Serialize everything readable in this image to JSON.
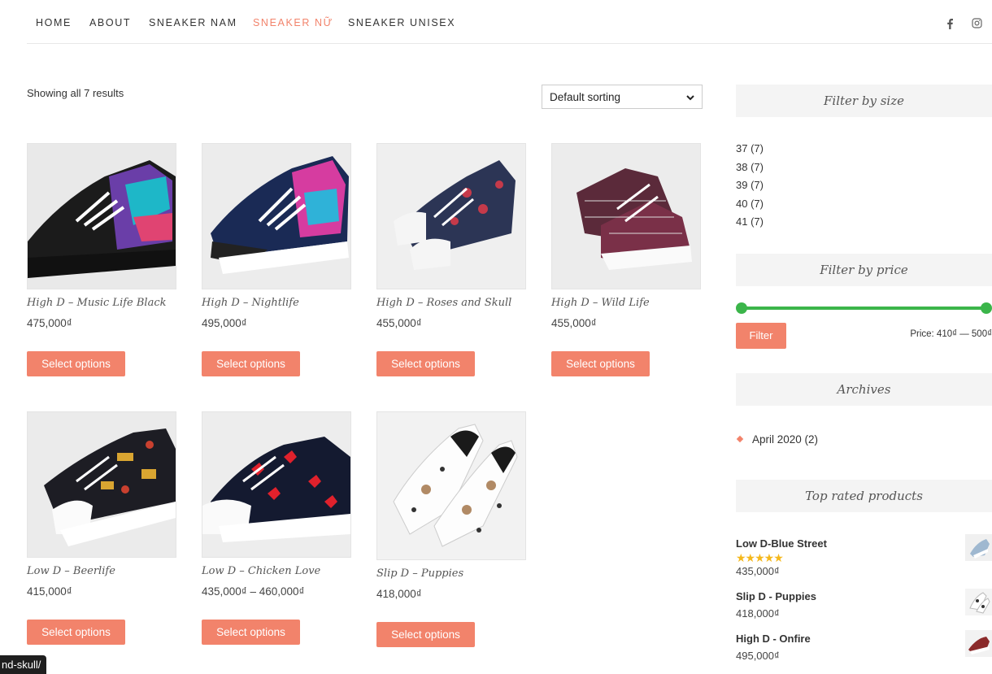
{
  "nav": {
    "items": [
      {
        "label": "HOME"
      },
      {
        "label": "ABOUT"
      },
      {
        "label": "SNEAKER NAM"
      },
      {
        "label": "SNEAKER NỮ"
      },
      {
        "label": "SNEAKER UNISEX"
      }
    ],
    "active_item": "SNEAKER NỮ",
    "social_icons": [
      "facebook-icon",
      "instagram-icon"
    ]
  },
  "shop": {
    "results_text": "Showing all 7 results",
    "sort_selected": "Default sorting"
  },
  "products": [
    {
      "title": "High D – Music Life Black",
      "price": "475,000₫",
      "button": "Select options"
    },
    {
      "title": "High D – Nightlife",
      "price": "495,000₫",
      "button": "Select options"
    },
    {
      "title": "High D – Roses and Skull",
      "price": "455,000₫",
      "button": "Select options"
    },
    {
      "title": "High D – Wild Life",
      "price": "455,000₫",
      "button": "Select options"
    },
    {
      "title": "Low D – Beerlife",
      "price": "415,000₫",
      "button": "Select options"
    },
    {
      "title": "Low D – Chicken Love",
      "price": "435,000₫ – 460,000₫",
      "button": "Select options"
    },
    {
      "title": "Slip D – Puppies",
      "price": "418,000₫",
      "button": "Select options"
    }
  ],
  "sidebar": {
    "size_filter": {
      "title": "Filter by size",
      "options": [
        "37 (7)",
        "38 (7)",
        "39 (7)",
        "40 (7)",
        "41 (7)"
      ]
    },
    "price_filter": {
      "title": "Filter by price",
      "button": "Filter",
      "price_text": "Price: 410₫ — 500₫",
      "range_selected_fraction": [
        0,
        1
      ]
    },
    "archives": {
      "title": "Archives",
      "items": [
        "April 2020 (2)"
      ]
    },
    "top_rated": {
      "title": "Top rated products",
      "items": [
        {
          "name": "Low D-Blue Street",
          "price": "435,000₫",
          "rating": 5
        },
        {
          "name": "Slip D - Puppies",
          "price": "418,000₫"
        },
        {
          "name": "High D - Onfire",
          "price": "495,000₫"
        }
      ]
    }
  },
  "status_bar": {
    "url_fragment": "nd-skull/"
  },
  "colors": {
    "accent": "#f2836b",
    "slider": "#3bb54a",
    "star": "#f5b81c"
  }
}
